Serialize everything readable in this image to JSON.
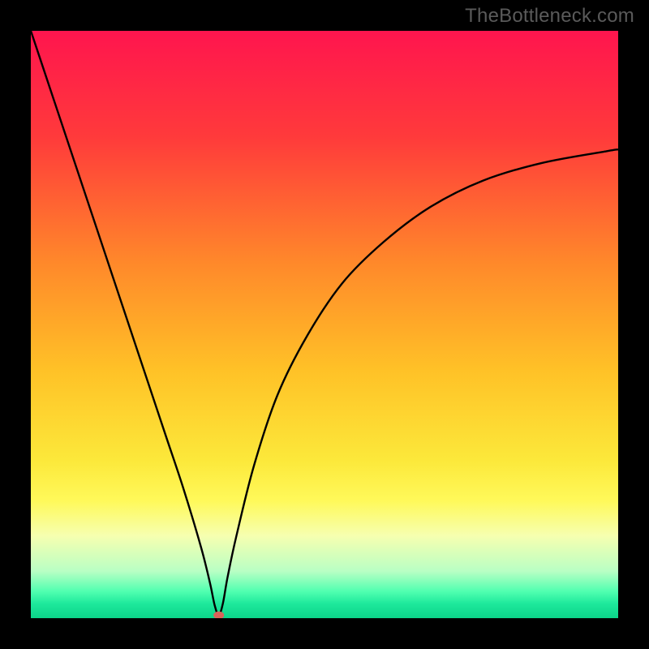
{
  "watermark": "TheBottleneck.com",
  "chart_data": {
    "type": "line",
    "title": "",
    "xlabel": "",
    "ylabel": "",
    "xlim": [
      0,
      100
    ],
    "ylim": [
      0,
      100
    ],
    "gradient_stops": [
      {
        "offset": 0.0,
        "color": "#ff154e"
      },
      {
        "offset": 0.18,
        "color": "#ff3a3b"
      },
      {
        "offset": 0.4,
        "color": "#ff8a2a"
      },
      {
        "offset": 0.58,
        "color": "#ffc227"
      },
      {
        "offset": 0.73,
        "color": "#fce83a"
      },
      {
        "offset": 0.8,
        "color": "#fff95a"
      },
      {
        "offset": 0.86,
        "color": "#f6ffb0"
      },
      {
        "offset": 0.92,
        "color": "#b9ffc4"
      },
      {
        "offset": 0.955,
        "color": "#4fffb0"
      },
      {
        "offset": 0.975,
        "color": "#1ee99c"
      },
      {
        "offset": 1.0,
        "color": "#0cd489"
      }
    ],
    "series": [
      {
        "name": "bottleneck-curve",
        "x": [
          0,
          2,
          5,
          8,
          11,
          14,
          17,
          20,
          23,
          26,
          29,
          30.5,
          31.3,
          32,
          32.7,
          33.5,
          35,
          38,
          42,
          47,
          53,
          60,
          68,
          77,
          87,
          98,
          100
        ],
        "y": [
          100,
          94,
          85,
          76,
          67,
          58,
          49,
          40,
          31,
          22,
          12,
          6,
          2.2,
          0.5,
          2.5,
          7,
          14,
          26,
          38,
          48,
          57,
          64,
          70,
          74.5,
          77.5,
          79.5,
          79.8
        ]
      }
    ],
    "marker": {
      "x": 32,
      "y": 0.5
    }
  }
}
